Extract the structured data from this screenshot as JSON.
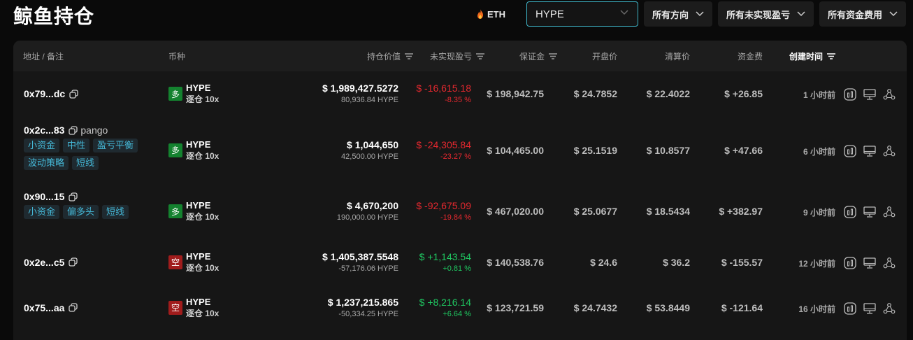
{
  "page_title": "鲸鱼持仓",
  "toolbar": {
    "eth_label": "ETH",
    "search_value": "HYPE",
    "filters": [
      "所有方向",
      "所有未实现盈亏",
      "所有资金费用"
    ]
  },
  "table": {
    "headers": {
      "address": "地址 / 备注",
      "coin": "币种",
      "value": "持仓价值",
      "pnl": "未实现盈亏",
      "margin": "保证金",
      "entry": "开盘价",
      "liq": "清算价",
      "funding": "资金费",
      "created": "创建时间"
    },
    "rows": [
      {
        "address": "0x79...dc",
        "note": "",
        "tags": [],
        "side": "多",
        "coin": "HYPE",
        "mode": "逐仓 10x",
        "value": "$ 1,989,427.5272",
        "size": "80,936.84 HYPE",
        "pnl": "$ -16,615.18",
        "pnl_pct": "-8.35 %",
        "margin": "$ 198,942.75",
        "entry": "$ 24.7852",
        "liq": "$ 22.4022",
        "funding": "$ +26.85",
        "created": "1 小时前"
      },
      {
        "address": "0x2c...83",
        "note": "pango",
        "tags": [
          "小资金",
          "中性",
          "盈亏平衡",
          "波动策略",
          "短线"
        ],
        "side": "多",
        "coin": "HYPE",
        "mode": "逐仓 10x",
        "value": "$ 1,044,650",
        "size": "42,500.00 HYPE",
        "pnl": "$ -24,305.84",
        "pnl_pct": "-23.27 %",
        "margin": "$ 104,465.00",
        "entry": "$ 25.1519",
        "liq": "$ 10.8577",
        "funding": "$ +47.66",
        "created": "6 小时前"
      },
      {
        "address": "0x90...15",
        "note": "",
        "tags": [
          "小资金",
          "偏多头",
          "短线"
        ],
        "side": "多",
        "coin": "HYPE",
        "mode": "逐仓 10x",
        "value": "$ 4,670,200",
        "size": "190,000.00 HYPE",
        "pnl": "$ -92,675.09",
        "pnl_pct": "-19.84 %",
        "margin": "$ 467,020.00",
        "entry": "$ 25.0677",
        "liq": "$ 18.5434",
        "funding": "$ +382.97",
        "created": "9 小时前"
      },
      {
        "address": "0x2e...c5",
        "note": "",
        "tags": [],
        "side": "空",
        "coin": "HYPE",
        "mode": "逐仓 10x",
        "value": "$ 1,405,387.5548",
        "size": "-57,176.06 HYPE",
        "pnl": "$ +1,143.54",
        "pnl_pct": "+0.81 %",
        "margin": "$ 140,538.76",
        "entry": "$ 24.6",
        "liq": "$ 36.2",
        "funding": "$ -155.57",
        "created": "12 小时前"
      },
      {
        "address": "0x75...aa",
        "note": "",
        "tags": [],
        "side": "空",
        "coin": "HYPE",
        "mode": "逐仓 10x",
        "value": "$ 1,237,215.865",
        "size": "-50,334.25 HYPE",
        "pnl": "$ +8,216.14",
        "pnl_pct": "+6.64 %",
        "margin": "$ 123,721.59",
        "entry": "$ 24.7432",
        "liq": "$ 53.8449",
        "funding": "$ -121.64",
        "created": "16 小时前"
      }
    ]
  },
  "colors": {
    "accent": "#3fb6c9",
    "positive": "#1fc861",
    "negative": "#e5282f",
    "long_badge": "#14822f",
    "short_badge": "#a01c1c",
    "tag_text": "#45b9d8"
  },
  "icons": {
    "eth": "fire-icon",
    "copy": "copy-icon",
    "row_actions": [
      "chart-icon",
      "monitor-icon",
      "network-icon"
    ]
  }
}
